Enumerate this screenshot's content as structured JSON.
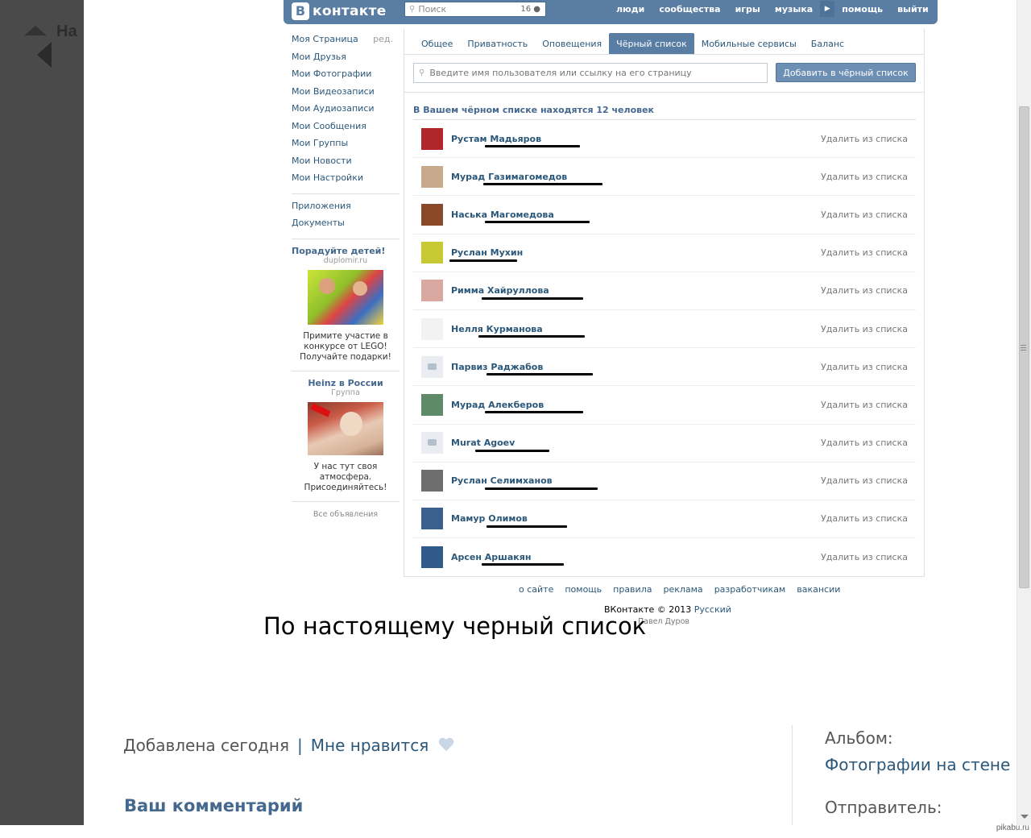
{
  "viewer": {
    "back_text": "На"
  },
  "vk": {
    "logo_text": "контакте",
    "logo_letter": "В",
    "search_placeholder": "Поиск",
    "search_count": "16",
    "nav": [
      "люди",
      "сообщества",
      "игры",
      "музыка",
      "помощь",
      "выйти"
    ],
    "left_menu": [
      {
        "label": "Моя Страница",
        "extra": "ред."
      },
      {
        "label": "Мои Друзья"
      },
      {
        "label": "Мои Фотографии"
      },
      {
        "label": "Мои Видеозаписи"
      },
      {
        "label": "Мои Аудиозаписи"
      },
      {
        "label": "Мои Сообщения"
      },
      {
        "label": "Мои Группы"
      },
      {
        "label": "Мои Новости"
      },
      {
        "label": "Мои Настройки"
      }
    ],
    "left_menu2": [
      "Приложения",
      "Документы"
    ],
    "ads": [
      {
        "title": "Порадуйте детей!",
        "sub": "duplomir.ru",
        "desc": "Примите участие в конкурсе от LEGO! Получайте подарки!"
      },
      {
        "title": "Heinz в России",
        "sub": "Группа",
        "desc": "У нас тут своя атмосфера. Присоединяйтесь!"
      }
    ],
    "all_ads": "Все объявления",
    "tabs": [
      "Общее",
      "Приватность",
      "Оповещения",
      "Чёрный список",
      "Мобильные сервисы",
      "Баланс"
    ],
    "active_tab": "Чёрный список",
    "blacklist_placeholder": "Введите имя пользователя или ссылку на его страницу",
    "add_button": "Добавить в чёрный список",
    "count_text": "В Вашем чёрном списке находятся 12 человек",
    "remove_label": "Удалить из списка",
    "users": [
      {
        "name": "Рустам Мадьяров",
        "avatar": "#b0262b"
      },
      {
        "name": "Мурад Газимагомедов",
        "avatar": "#c9a98c"
      },
      {
        "name": "Наська Магомедова",
        "avatar": "#8a4a2a"
      },
      {
        "name": "Руслан Мухин",
        "avatar": "#c8c832"
      },
      {
        "name": "Римма Хайруллова",
        "avatar": "#d9a8a0"
      },
      {
        "name": "Нелля Курманова",
        "avatar": "#f2f2f2"
      },
      {
        "name": "Парвиз Раджабов",
        "avatar": "camera"
      },
      {
        "name": "Мурад Алекберов",
        "avatar": "#5f8a6a"
      },
      {
        "name": "Murat Agoev",
        "avatar": "camera"
      },
      {
        "name": "Руслан Селимханов",
        "avatar": "#6e6e6e"
      },
      {
        "name": "Мамур Олимов",
        "avatar": "#3b5f8f"
      },
      {
        "name": "Арсен Аршакян",
        "avatar": "#2f5a8a"
      }
    ],
    "footer_links": [
      "о сайте",
      "помощь",
      "правила",
      "реклама",
      "разработчикам",
      "вакансии"
    ],
    "copyright": "ВКонтакте © 2013",
    "language": "Русский",
    "author": "Павел Дуров"
  },
  "caption": "По настоящему черный список",
  "post_meta": {
    "added": "Добавлена сегодня",
    "separator": "|",
    "like": "Мне нравится"
  },
  "comment_title": "Ваш комментарий",
  "sidebar": {
    "album_label": "Альбом:",
    "album_link": "Фотографии на стене Н",
    "sender_label": "Отправитель:"
  },
  "watermark": "pikabu.ru"
}
